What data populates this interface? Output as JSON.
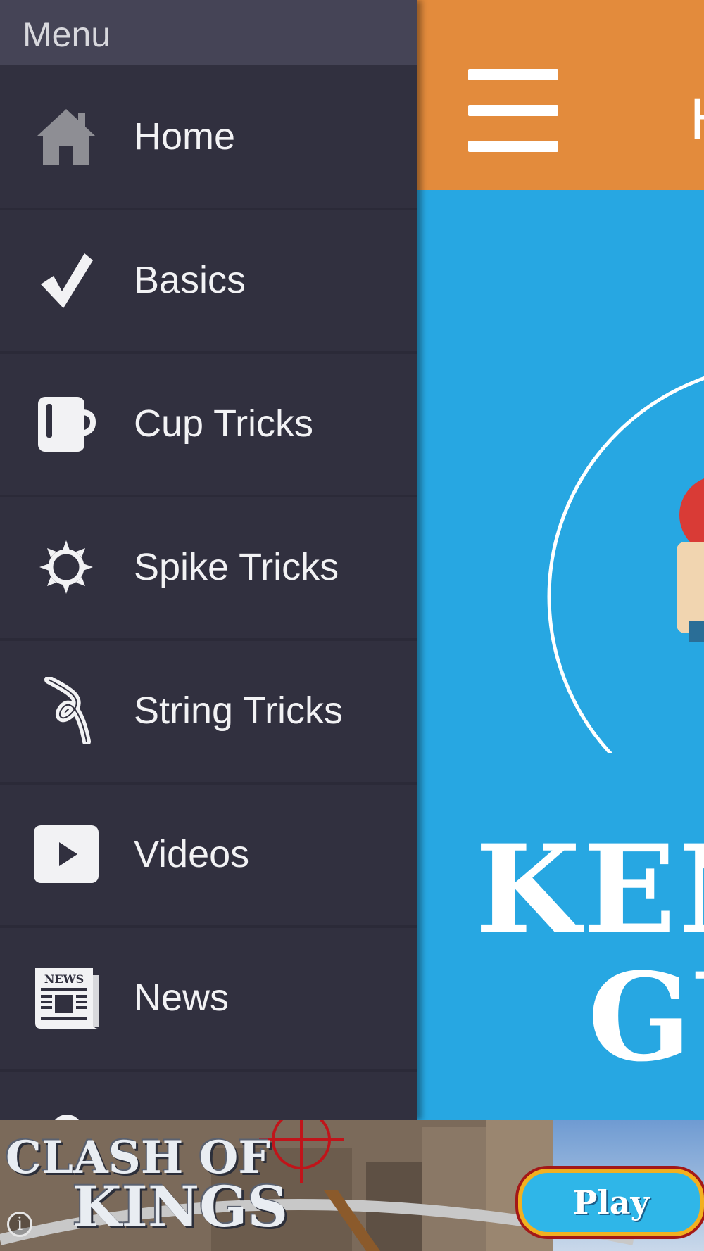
{
  "drawer": {
    "title": "Menu",
    "items": [
      {
        "label": "Home",
        "icon": "home-icon"
      },
      {
        "label": "Basics",
        "icon": "checkmark-icon"
      },
      {
        "label": "Cup Tricks",
        "icon": "cup-icon"
      },
      {
        "label": "Spike Tricks",
        "icon": "spike-icon"
      },
      {
        "label": "String Tricks",
        "icon": "knot-icon"
      },
      {
        "label": "Videos",
        "icon": "play-icon"
      },
      {
        "label": "News",
        "icon": "newspaper-icon"
      },
      {
        "label": "",
        "icon": "cloud-icon"
      }
    ],
    "news_icon_text": "NEWS"
  },
  "main": {
    "header_title_partial": "H",
    "brand_line1": "KEN",
    "brand_line2": "GU"
  },
  "ad": {
    "title_line1": "CLASH OF",
    "title_line2": "KINGS",
    "play_label": "Play",
    "info_label": "i"
  },
  "colors": {
    "drawer_bg": "#31303f",
    "drawer_header": "#454456",
    "topbar": "#e38b3c",
    "content_bg": "#27a7e2"
  }
}
